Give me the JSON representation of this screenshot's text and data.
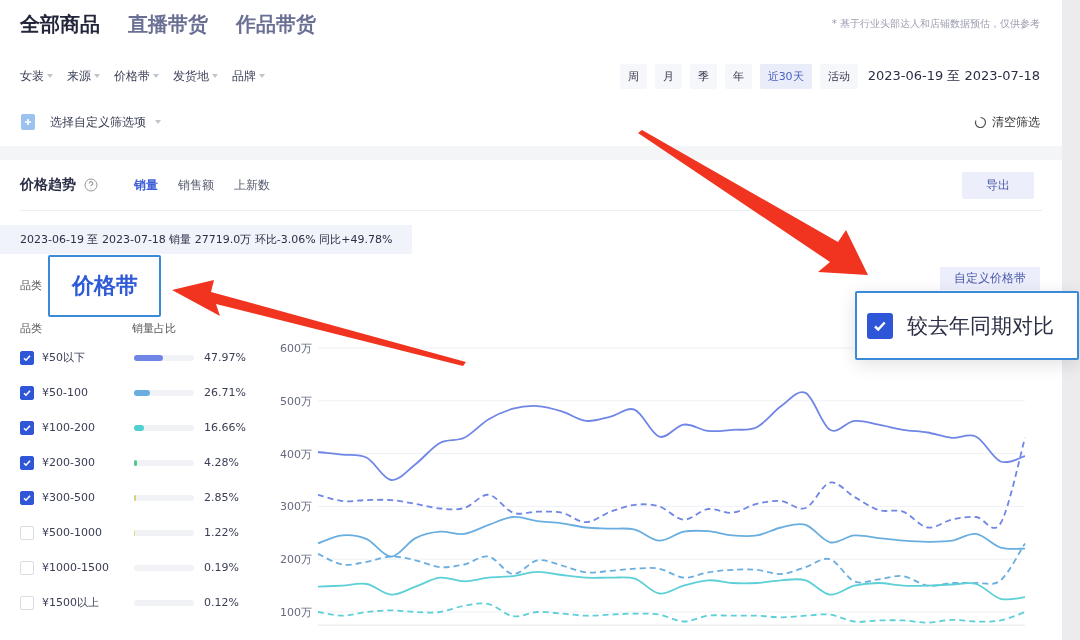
{
  "tabs": [
    {
      "label": "全部商品",
      "selected": true
    },
    {
      "label": "直播带货",
      "selected": false
    },
    {
      "label": "作品带货",
      "selected": false
    }
  ],
  "disclaimer": "* 基于行业头部达人和店铺数据预估，仅供参考",
  "filters": [
    "女装",
    "来源",
    "价格带",
    "发货地",
    "品牌"
  ],
  "periods": [
    {
      "label": "周",
      "selected": false
    },
    {
      "label": "月",
      "selected": false
    },
    {
      "label": "季",
      "selected": false
    },
    {
      "label": "年",
      "selected": false
    },
    {
      "label": "近30天",
      "selected": true
    },
    {
      "label": "活动",
      "selected": false
    }
  ],
  "date_range": "2023-06-19 至 2023-07-18",
  "custom_filter": "选择自定义筛选项",
  "clear_filter": "清空筛选",
  "panel": {
    "title": "价格趋势",
    "metric_tabs": [
      {
        "label": "销量",
        "selected": true
      },
      {
        "label": "销售额",
        "selected": false
      },
      {
        "label": "上新数",
        "selected": false
      }
    ],
    "export": "导出",
    "summary": "2023-06-19 至 2023-07-18 销量 27719.0万 环比-3.06% 同比+49.78%",
    "category_label": "品类",
    "custom_price_band": "自定义价格带",
    "list_header": [
      "品类",
      "销量占比"
    ],
    "bands": [
      {
        "label": "¥50以下",
        "checked": true,
        "level": 0.4797,
        "share": "47.97%",
        "color": "#6f86e6"
      },
      {
        "label": "¥50-100",
        "checked": true,
        "level": 0.2671,
        "share": "26.71%",
        "color": "#6aaee0"
      },
      {
        "label": "¥100-200",
        "checked": true,
        "level": 0.1666,
        "share": "16.66%",
        "color": "#4fcfd0"
      },
      {
        "label": "¥200-300",
        "checked": true,
        "level": 0.0428,
        "share": "4.28%",
        "color": "#52c98a"
      },
      {
        "label": "¥300-500",
        "checked": true,
        "level": 0.0285,
        "share": "2.85%",
        "color": "#d8d27a"
      },
      {
        "label": "¥500-1000",
        "checked": false,
        "level": 0.0122,
        "share": "1.22%",
        "color": "#e6d98a"
      },
      {
        "label": "¥1000-1500",
        "checked": false,
        "level": 0.0019,
        "share": "0.19%"
      },
      {
        "label": "¥1500以上",
        "checked": false,
        "level": 0.0012,
        "share": "0.12%"
      }
    ],
    "chart_data": {
      "type": "line",
      "ylim": [
        75,
        600
      ],
      "grid": true,
      "yticks": [
        {
          "value": 100,
          "label": "100万"
        },
        {
          "value": 200,
          "label": "200万"
        },
        {
          "value": 300,
          "label": "300万"
        },
        {
          "value": 400,
          "label": "400万"
        },
        {
          "value": 500,
          "label": "500万"
        },
        {
          "value": 600,
          "label": "600万"
        }
      ],
      "series": [
        {
          "color": "#6f86e6",
          "line_style": "solid",
          "values": [
            403,
            398,
            392,
            350,
            380,
            420,
            430,
            465,
            485,
            490,
            480,
            462,
            470,
            483,
            432,
            455,
            443,
            445,
            450,
            490,
            515,
            445,
            462,
            455,
            445,
            440,
            430,
            432,
            385,
            395
          ]
        },
        {
          "color": "#6f86e6",
          "line_style": "dashed",
          "values": [
            322,
            310,
            312,
            312,
            305,
            296,
            297,
            322,
            288,
            290,
            288,
            270,
            290,
            303,
            300,
            275,
            295,
            288,
            305,
            310,
            297,
            345,
            318,
            293,
            290,
            260,
            275,
            280,
            268,
            430
          ]
        },
        {
          "color": "#6aaee0",
          "line_style": "solid",
          "values": [
            230,
            245,
            238,
            205,
            240,
            252,
            248,
            265,
            280,
            272,
            268,
            260,
            258,
            256,
            235,
            252,
            253,
            245,
            245,
            260,
            265,
            232,
            245,
            240,
            235,
            233,
            235,
            248,
            222,
            220
          ]
        },
        {
          "color": "#6aaee0",
          "line_style": "dashed",
          "values": [
            210,
            190,
            195,
            205,
            198,
            185,
            190,
            205,
            172,
            198,
            188,
            175,
            178,
            182,
            182,
            165,
            175,
            180,
            180,
            172,
            185,
            200,
            158,
            162,
            168,
            150,
            155,
            155,
            160,
            230
          ]
        },
        {
          "color": "#5cd0d6",
          "line_style": "solid",
          "values": [
            148,
            150,
            153,
            133,
            148,
            165,
            158,
            165,
            168,
            176,
            170,
            165,
            165,
            163,
            135,
            150,
            160,
            155,
            155,
            160,
            160,
            133,
            150,
            155,
            150,
            150,
            152,
            153,
            125,
            128
          ]
        },
        {
          "color": "#5cd0d6",
          "line_style": "dashed",
          "values": [
            100,
            93,
            100,
            103,
            100,
            100,
            112,
            115,
            92,
            100,
            97,
            93,
            95,
            97,
            95,
            82,
            93,
            93,
            93,
            90,
            93,
            95,
            82,
            84,
            84,
            80,
            85,
            82,
            84,
            100
          ]
        }
      ]
    }
  },
  "callouts": [
    {
      "kind": "label",
      "text": "价格带"
    },
    {
      "kind": "checkbox",
      "text": "较去年同期对比",
      "checked": true
    }
  ]
}
